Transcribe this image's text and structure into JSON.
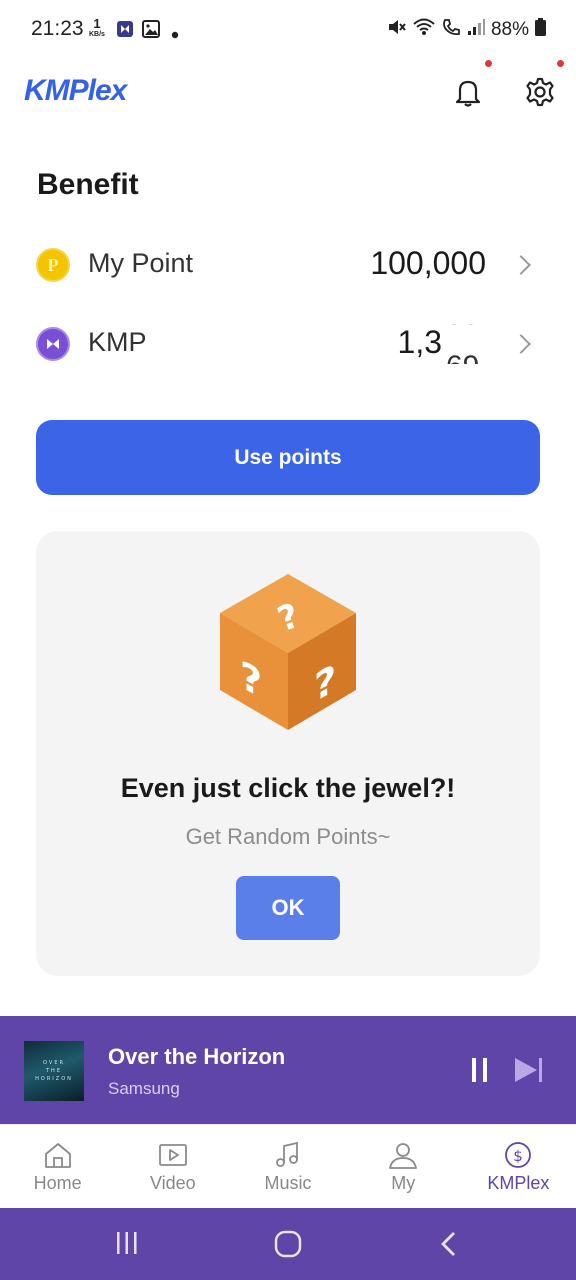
{
  "status_bar": {
    "time": "21:23",
    "speed_value": "1",
    "speed_unit": "KB/s",
    "battery": "88%"
  },
  "header": {
    "logo": "KMPlex",
    "icons": [
      "bell-icon",
      "gear-icon"
    ]
  },
  "benefit": {
    "title": "Benefit",
    "rows": [
      {
        "label": "My Point",
        "value": "100,000",
        "icon": "point-coin-icon"
      },
      {
        "label": "KMP",
        "value": "1,3",
        "icon": "kmp-coin-icon"
      }
    ]
  },
  "use_points_label": "Use points",
  "jewel": {
    "title": "Even just click the jewel?!",
    "subtitle": "Get Random Points~",
    "ok_label": "OK"
  },
  "player": {
    "track_title": "Over the Horizon",
    "artist": "Samsung",
    "album_lines": [
      "OVER",
      "THE",
      "HORIZON"
    ]
  },
  "nav": {
    "items": [
      {
        "label": "Home",
        "icon": "home-icon"
      },
      {
        "label": "Video",
        "icon": "video-icon"
      },
      {
        "label": "Music",
        "icon": "music-icon"
      },
      {
        "label": "My",
        "icon": "user-icon"
      },
      {
        "label": "KMPlex",
        "icon": "dollar-icon",
        "active": true
      }
    ]
  },
  "colors": {
    "brand_blue": "#3b64e6",
    "brand_purple": "#5f45a8",
    "jewel_orange": "#e8913a"
  }
}
